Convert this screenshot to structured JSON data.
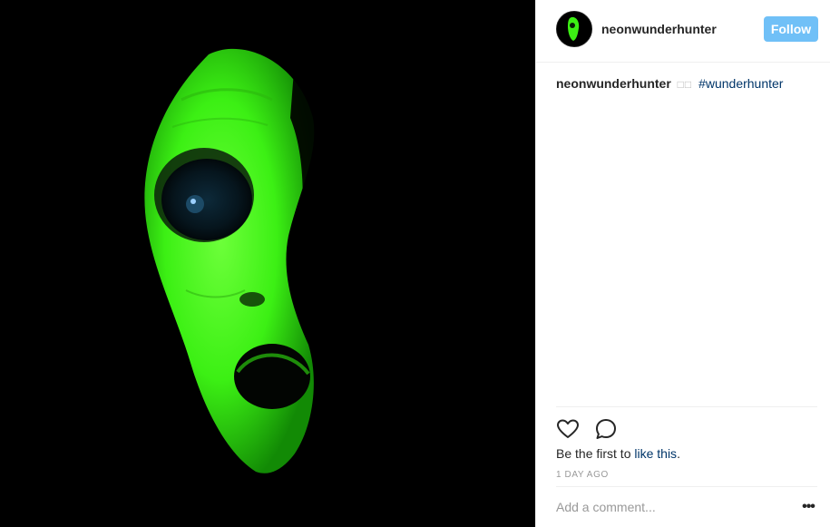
{
  "post": {
    "media_alt_icon": "neon-green-face-photo",
    "accent_color": "#39ff14"
  },
  "header": {
    "username": "neonwunderhunter",
    "follow_label": "Follow",
    "follow_color": "#70c0f7"
  },
  "caption": {
    "username": "neonwunderhunter",
    "emoji_placeholder": "□□",
    "hashtag": "#wunderhunter"
  },
  "actions": {
    "like_icon": "heart-icon",
    "comment_icon": "comment-bubble-icon"
  },
  "likes": {
    "prefix": "Be the first to ",
    "link_text": "like this",
    "suffix": "."
  },
  "timestamp": "1 DAY AGO",
  "comment": {
    "placeholder": "Add a comment...",
    "more_label": "•••"
  }
}
